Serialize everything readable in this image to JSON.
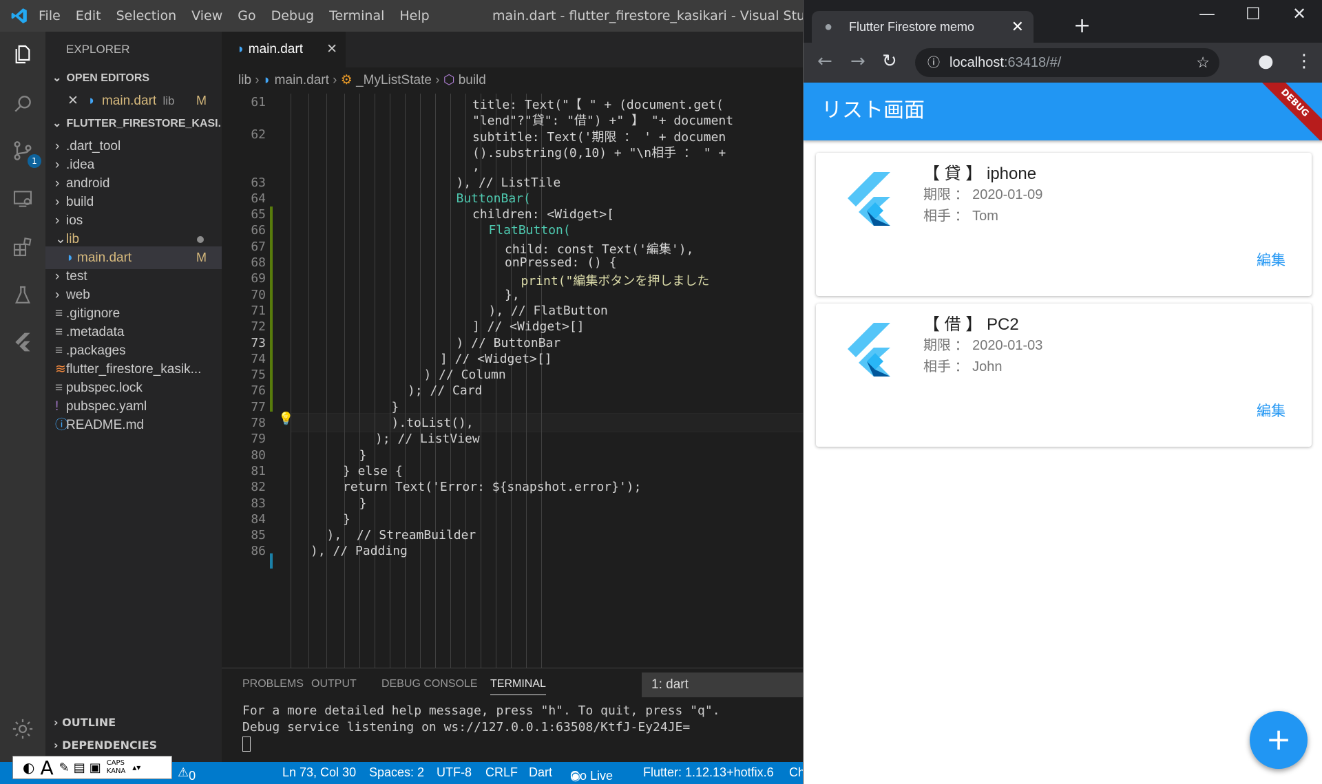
{
  "vscode": {
    "menu": [
      "File",
      "Edit",
      "Selection",
      "View",
      "Go",
      "Debug",
      "Terminal",
      "Help"
    ],
    "window_title": "main.dart - flutter_firestore_kasikari - Visual Studio Code",
    "explorer_title": "EXPLORER",
    "open_editors_label": "OPEN EDITORS",
    "open_editor": {
      "name": "main.dart",
      "dir": "lib",
      "status": "M"
    },
    "project_label": "FLUTTER_FIRESTORE_KASI...",
    "tree": [
      {
        "name": ".dart_tool",
        "type": "folder"
      },
      {
        "name": ".idea",
        "type": "folder"
      },
      {
        "name": "android",
        "type": "folder"
      },
      {
        "name": "build",
        "type": "folder"
      },
      {
        "name": "ios",
        "type": "folder"
      },
      {
        "name": "lib",
        "type": "folder-open"
      },
      {
        "name": "main.dart",
        "type": "file-dart",
        "status": "M"
      },
      {
        "name": "test",
        "type": "folder"
      },
      {
        "name": "web",
        "type": "folder"
      },
      {
        "name": ".gitignore",
        "type": "file"
      },
      {
        "name": ".metadata",
        "type": "file"
      },
      {
        "name": ".packages",
        "type": "file"
      },
      {
        "name": "flutter_firestore_kasik...",
        "type": "file-rss"
      },
      {
        "name": "pubspec.lock",
        "type": "file"
      },
      {
        "name": "pubspec.yaml",
        "type": "file-yaml"
      },
      {
        "name": "README.md",
        "type": "file-info"
      }
    ],
    "outline_label": "OUTLINE",
    "dependencies_label": "DEPENDENCIES",
    "scm_badge": "1",
    "tab_label": "main.dart",
    "breadcrumb": [
      "lib",
      "main.dart",
      "_MyListState",
      "build"
    ],
    "code_lines": [
      {
        "n": "61",
        "t": "title: Text(\"【 \" + (document.get("
      },
      {
        "n": "",
        "t": "\"lend\"?\"貸\": \"借\") +\" 】 \"+ document"
      },
      {
        "n": "62",
        "t": "subtitle: Text('期限 ： ' + documen"
      },
      {
        "n": "",
        "t": "().substring(0,10) + \"\\n相手 ： \" +"
      },
      {
        "n": "",
        "t": ","
      },
      {
        "n": "63",
        "t": "), // ListTile"
      },
      {
        "n": "64",
        "t": "ButtonBar("
      },
      {
        "n": "65",
        "t": "children: <Widget>["
      },
      {
        "n": "66",
        "t": "FlatButton("
      },
      {
        "n": "67",
        "t": "child: const Text('編集'),"
      },
      {
        "n": "68",
        "t": "onPressed: () {"
      },
      {
        "n": "69",
        "t": "print(\"編集ボタンを押しました"
      },
      {
        "n": "70",
        "t": "},"
      },
      {
        "n": "71",
        "t": "), // FlatButton"
      },
      {
        "n": "72",
        "t": "] // <Widget>[]"
      },
      {
        "n": "73",
        "t": ") // ButtonBar"
      },
      {
        "n": "74",
        "t": "] // <Widget>[]"
      },
      {
        "n": "75",
        "t": ") // Column"
      },
      {
        "n": "76",
        "t": "); // Card"
      },
      {
        "n": "77",
        "t": "}"
      },
      {
        "n": "78",
        "t": ").toList(),"
      },
      {
        "n": "79",
        "t": "); // ListView"
      },
      {
        "n": "80",
        "t": "}"
      },
      {
        "n": "81",
        "t": "} else {"
      },
      {
        "n": "82",
        "t": "return Text('Error: ${snapshot.error}');"
      },
      {
        "n": "83",
        "t": "}"
      },
      {
        "n": "84",
        "t": "}"
      },
      {
        "n": "85",
        "t": "),  // StreamBuilder"
      },
      {
        "n": "86",
        "t": "), // Padding"
      }
    ],
    "panel_tabs": [
      "PROBLEMS",
      "OUTPUT",
      "DEBUG CONSOLE",
      "TERMINAL"
    ],
    "terminal_select": "1: dart",
    "terminal_lines": [
      "For a more detailed help message, press \"h\". To quit, press \"q\".",
      "Debug service listening on ws://127.0.0.1:63508/KtfJ-Ey24JE="
    ],
    "status": {
      "warnings": "0",
      "position": "Ln 73, Col 30",
      "spaces": "Spaces: 2",
      "encoding": "UTF-8",
      "eol": "CRLF",
      "language": "Dart",
      "golive": "Go Live",
      "flutter": "Flutter: 1.12.13+hotfix.6",
      "extra": "Ch"
    },
    "ime": {
      "caps": "CAPS",
      "kana": "KANA"
    }
  },
  "browser": {
    "tab_title": "Flutter Firestore memo",
    "url_host": "localhost",
    "url_rest": ":63418/#/",
    "app_title": "リスト画面",
    "debug_banner": "DEBUG",
    "items": [
      {
        "title": "【 貸 】 iphone",
        "deadline": "期限 ： 2020-01-09",
        "partner": "相手 ： Tom",
        "action": "編集"
      },
      {
        "title": "【 借 】 PC2",
        "deadline": "期限 ： 2020-01-03",
        "partner": "相手 ： John",
        "action": "編集"
      }
    ],
    "fab_label": "+"
  },
  "colors": {
    "accent": "#2196f3",
    "status_bar": "#007acc",
    "debug_banner": "#b71c1c"
  }
}
